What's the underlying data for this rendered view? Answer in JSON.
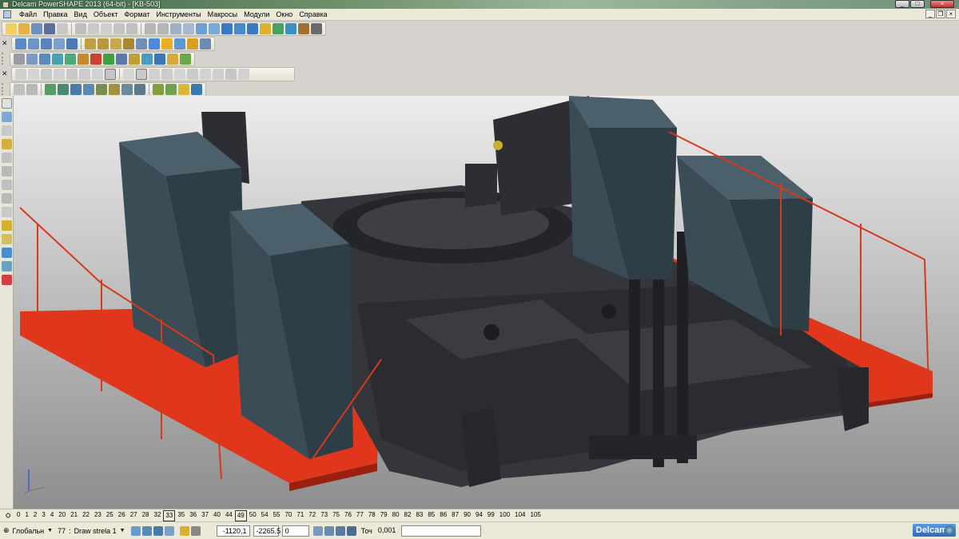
{
  "window": {
    "title": "Delcam PowerSHAPE 2013 (64-bit) - [KB-503]",
    "minimize": "_",
    "maximize": "□",
    "close": "×"
  },
  "menu": {
    "items": [
      "Файл",
      "Правка",
      "Вид",
      "Объект",
      "Формат",
      "Инструменты",
      "Макросы",
      "Модули",
      "Окно",
      "Справка"
    ]
  },
  "mdi_controls": {
    "minimize": "_",
    "restore": "❐",
    "close": "×"
  },
  "layers": {
    "numbers": [
      "0",
      "1",
      "2",
      "3",
      "4",
      "20",
      "21",
      "22",
      "23",
      "25",
      "26",
      "27",
      "28",
      "32",
      "33",
      "35",
      "36",
      "37",
      "40",
      "44",
      "49",
      "50",
      "54",
      "55",
      "70",
      "71",
      "72",
      "73",
      "75",
      "76",
      "77",
      "78",
      "79",
      "80",
      "82",
      "83",
      "85",
      "86",
      "87",
      "90",
      "94",
      "99",
      "100",
      "104",
      "105"
    ],
    "boxed": [
      "33",
      "49"
    ]
  },
  "status": {
    "workplane": "Глобальн",
    "level_number": "77",
    "level_name": "Draw strela 1",
    "coord_x": "-1120,1",
    "coord_y": "-2265,5",
    "coord_z": "0",
    "tolerance_label": "Точ",
    "tolerance_value": "0,001",
    "brand": "Delcam"
  },
  "colors": {
    "platform": "#e0371c",
    "frame": "#2c2e33",
    "cabinet": "#3a4d57",
    "viewport_top": "#ededed",
    "viewport_bottom": "#8e8e8e"
  }
}
